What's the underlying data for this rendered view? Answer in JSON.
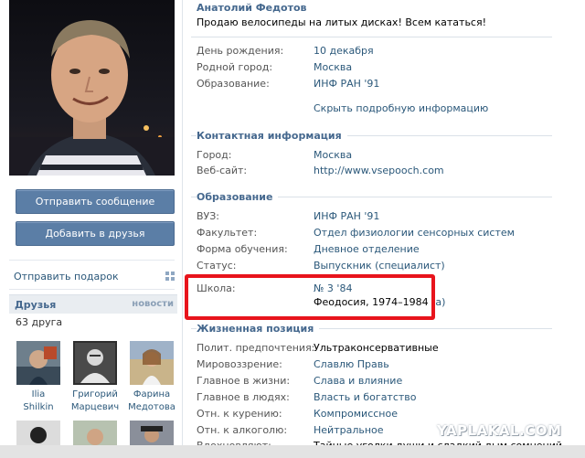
{
  "profile": {
    "name": "Анатолий Федотов",
    "status": "Продаю велосипеды на литых дисках! Всем кататься!"
  },
  "actions": {
    "send_message": "Отправить сообщение",
    "add_friend": "Добавить в друзья",
    "send_gift": "Отправить подарок"
  },
  "friends": {
    "title": "Друзья",
    "new_label": "новости",
    "count": "63 друга",
    "items": [
      {
        "first": "Ilia",
        "last": "Shilkin"
      },
      {
        "first": "Григорий",
        "last": "Марцевич"
      },
      {
        "first": "Фарина",
        "last": "Медотова"
      }
    ]
  },
  "basic": {
    "rows": [
      {
        "label": "День рождения:",
        "value": "10 декабря"
      },
      {
        "label": "Родной город:",
        "value": "Москва"
      },
      {
        "label": "Образование:",
        "value": "ИНФ РАН '91"
      }
    ],
    "show_more": "Скрыть подробную информацию"
  },
  "contacts": {
    "title": "Контактная информация",
    "rows": [
      {
        "label": "Город:",
        "value": "Москва"
      },
      {
        "label": "Веб-сайт:",
        "value": "http://www.vsepooch.com"
      }
    ]
  },
  "education": {
    "title": "Образование",
    "rows": [
      {
        "label": "ВУЗ:",
        "value": "ИНФ РАН '91"
      },
      {
        "label": "Факультет:",
        "value": "Отдел физиологии сенсорных систем"
      },
      {
        "label": "Форма обучения:",
        "value": "Дневное отделение"
      },
      {
        "label": "Статус:",
        "value": "Выпускник (специалист)"
      }
    ],
    "school": {
      "label": "Школа:",
      "value": "№ 3 '84",
      "details": "Феодосия, 1974–1984",
      "suffix": "(а)"
    }
  },
  "life_position": {
    "title": "Жизненная позиция",
    "rows": [
      {
        "label": "Полит. предпочтения:",
        "value": "Ультраконсервативные"
      },
      {
        "label": "Мировоззрение:",
        "value": "Славлю Правь"
      },
      {
        "label": "Главное в жизни:",
        "value": "Слава и влияние"
      },
      {
        "label": "Главное в людях:",
        "value": "Власть и богатство"
      },
      {
        "label": "Отн. к курению:",
        "value": "Компромиссное"
      },
      {
        "label": "Отн. к алкоголю:",
        "value": "Нейтральное"
      },
      {
        "label": "Вдохновляют:",
        "value": "Тайные уголки души и сладкий дым сомнений"
      }
    ]
  },
  "watermark": "YAPLAKAL.COM",
  "colors": {
    "link": "#2b587a",
    "header": "#45688e",
    "button": "#5b7ea6",
    "highlight": "#e8141c"
  }
}
